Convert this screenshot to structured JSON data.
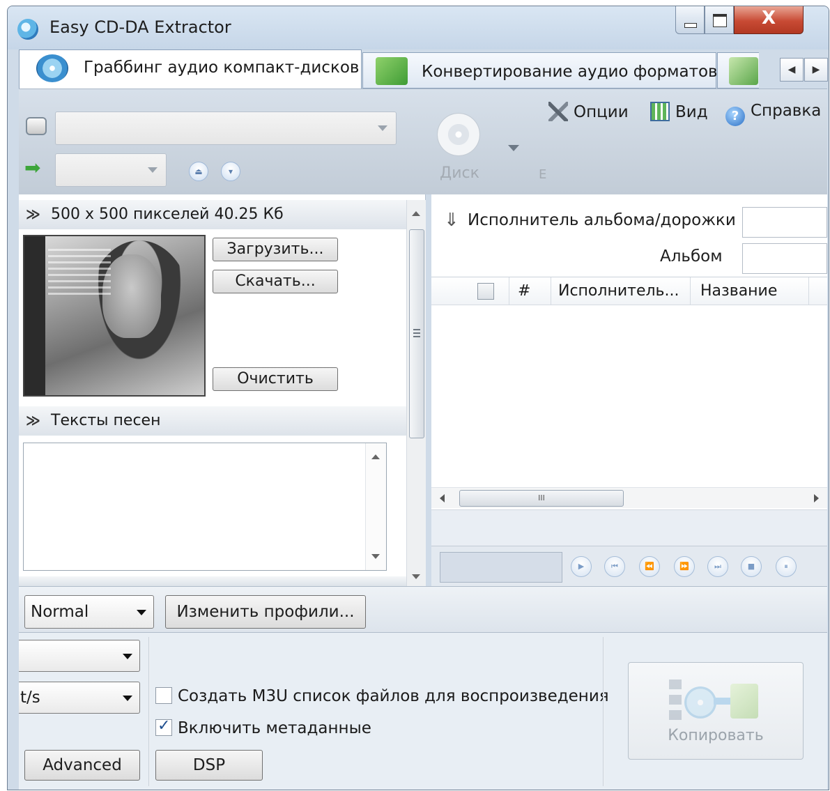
{
  "window": {
    "title": "Easy CD-DA Extractor",
    "close_glyph": "X",
    "icons": {
      "app": "cd-icon",
      "minimize": "minimize-icon",
      "maximize": "maximize-icon",
      "close": "close-icon"
    }
  },
  "tabs": [
    {
      "label": "Граббинг аудио компакт-дисков",
      "icon": "cd-rip-icon",
      "active": true
    },
    {
      "label": "Конвертирование аудио форматов",
      "icon": "music-file-icon",
      "active": false
    },
    {
      "label": "",
      "icon": "music-folder-icon",
      "active": false
    }
  ],
  "tab_scroll": {
    "left": "◀",
    "right": "▶"
  },
  "toolbar": {
    "drive_value": "",
    "speed_value": "",
    "eject_up": "⏏",
    "eject_down": "▾",
    "disk_label": "Диск",
    "faint_label": "E",
    "menu": {
      "options": "Опции",
      "view": "Вид",
      "help": "Справка"
    },
    "help_glyph": "?"
  },
  "cover_section": {
    "header": "500 x 500 пикселей  40.25 Кб",
    "buttons": {
      "load": "Загрузить...",
      "download": "Скачать...",
      "clear": "Очистить"
    }
  },
  "lyrics_section": {
    "header": "Тексты песен",
    "content": ""
  },
  "track_info": {
    "artist_label": "Исполнитель альбома/дорожки",
    "album_label": "Альбом",
    "artist_value": "",
    "album_value": ""
  },
  "track_list": {
    "columns": {
      "number": "#",
      "artist": "Исполнитель...",
      "title": "Название"
    },
    "rows": []
  },
  "hscroll_grip": "III",
  "player_buttons": [
    "▶",
    "⏮",
    "⏪",
    "⏩",
    "⏭",
    "■",
    "⏸"
  ],
  "profile": {
    "selected": "Normal",
    "edit_button": "Изменить профили..."
  },
  "output": {
    "combo1_value": "",
    "combo2_value": "t/s",
    "m3u_label": "Создать M3U список файлов для воспроизведения",
    "m3u_checked": false,
    "metadata_label": "Включить метаданные",
    "metadata_checked": true,
    "advanced_button": "Advanced",
    "dsp_button": "DSP",
    "copy_button": "Копировать"
  }
}
